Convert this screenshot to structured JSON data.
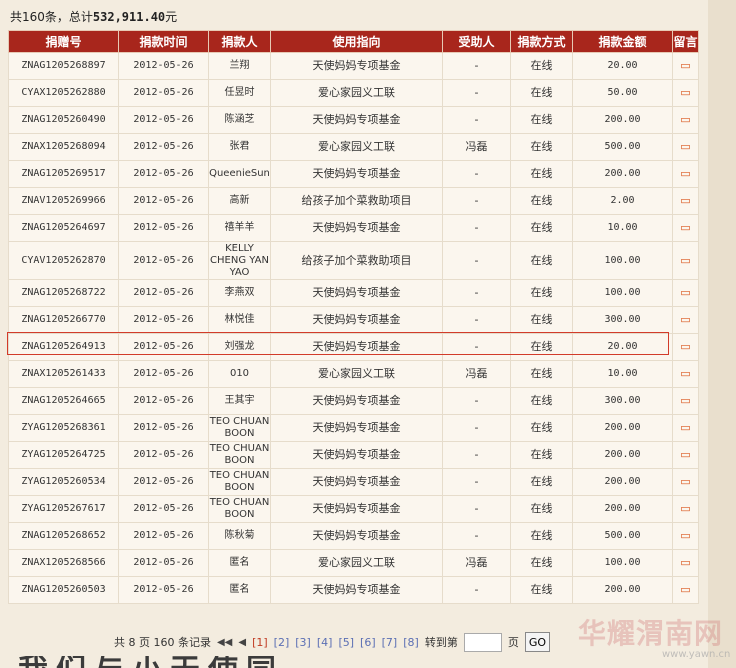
{
  "summary": {
    "prefix": "共160条，总计",
    "total": "532,911.40",
    "suffix": "元"
  },
  "table": {
    "headers": [
      "捐赠号",
      "捐款时间",
      "捐款人",
      "使用指向",
      "受助人",
      "捐款方式",
      "捐款金额",
      "留言"
    ],
    "rows": [
      {
        "id": "ZNAG1205268897",
        "date": "2012-05-26",
        "donor": "兰翔",
        "purpose": "天使妈妈专项基金",
        "recipient": "-",
        "method": "在线",
        "amount": "20.00"
      },
      {
        "id": "CYAX1205262880",
        "date": "2012-05-26",
        "donor": "任昱时",
        "purpose": "爱心家园义工联",
        "recipient": "-",
        "method": "在线",
        "amount": "50.00"
      },
      {
        "id": "ZNAG1205260490",
        "date": "2012-05-26",
        "donor": "陈涵芝",
        "purpose": "天使妈妈专项基金",
        "recipient": "-",
        "method": "在线",
        "amount": "200.00"
      },
      {
        "id": "ZNAX1205268094",
        "date": "2012-05-26",
        "donor": "张君",
        "purpose": "爱心家园义工联",
        "recipient": "冯磊",
        "method": "在线",
        "amount": "500.00"
      },
      {
        "id": "ZNAG1205269517",
        "date": "2012-05-26",
        "donor": "QueenieSun",
        "purpose": "天使妈妈专项基金",
        "recipient": "-",
        "method": "在线",
        "amount": "200.00"
      },
      {
        "id": "ZNAV1205269966",
        "date": "2012-05-26",
        "donor": "高新",
        "purpose": "给孩子加个菜救助项目",
        "recipient": "-",
        "method": "在线",
        "amount": "2.00"
      },
      {
        "id": "ZNAG1205264697",
        "date": "2012-05-26",
        "donor": "禧羊羊",
        "purpose": "天使妈妈专项基金",
        "recipient": "-",
        "method": "在线",
        "amount": "10.00"
      },
      {
        "id": "CYAV1205262870",
        "date": "2012-05-26",
        "donor": "KELLY CHENG YAN YAO",
        "purpose": "给孩子加个菜救助项目",
        "recipient": "-",
        "method": "在线",
        "amount": "100.00"
      },
      {
        "id": "ZNAG1205268722",
        "date": "2012-05-26",
        "donor": "李燕双",
        "purpose": "天使妈妈专项基金",
        "recipient": "-",
        "method": "在线",
        "amount": "100.00"
      },
      {
        "id": "ZNAG1205266770",
        "date": "2012-05-26",
        "donor": "林悦佳",
        "purpose": "天使妈妈专项基金",
        "recipient": "-",
        "method": "在线",
        "amount": "300.00"
      },
      {
        "id": "ZNAG1205264913",
        "date": "2012-05-26",
        "donor": "刘强龙",
        "purpose": "天使妈妈专项基金",
        "recipient": "-",
        "method": "在线",
        "amount": "20.00"
      },
      {
        "id": "ZNAX1205261433",
        "date": "2012-05-26",
        "donor": "010",
        "purpose": "爱心家园义工联",
        "recipient": "冯磊",
        "method": "在线",
        "amount": "10.00"
      },
      {
        "id": "ZNAG1205264665",
        "date": "2012-05-26",
        "donor": "王其宇",
        "purpose": "天使妈妈专项基金",
        "recipient": "-",
        "method": "在线",
        "amount": "300.00"
      },
      {
        "id": "ZYAG1205268361",
        "date": "2012-05-26",
        "donor": "TEO CHUAN BOON",
        "purpose": "天使妈妈专项基金",
        "recipient": "-",
        "method": "在线",
        "amount": "200.00"
      },
      {
        "id": "ZYAG1205264725",
        "date": "2012-05-26",
        "donor": "TEO CHUAN BOON",
        "purpose": "天使妈妈专项基金",
        "recipient": "-",
        "method": "在线",
        "amount": "200.00"
      },
      {
        "id": "ZYAG1205260534",
        "date": "2012-05-26",
        "donor": "TEO CHUAN BOON",
        "purpose": "天使妈妈专项基金",
        "recipient": "-",
        "method": "在线",
        "amount": "200.00"
      },
      {
        "id": "ZYAG1205267617",
        "date": "2012-05-26",
        "donor": "TEO CHUAN BOON",
        "purpose": "天使妈妈专项基金",
        "recipient": "-",
        "method": "在线",
        "amount": "200.00"
      },
      {
        "id": "ZNAG1205268652",
        "date": "2012-05-26",
        "donor": "陈秋菊",
        "purpose": "天使妈妈专项基金",
        "recipient": "-",
        "method": "在线",
        "amount": "500.00"
      },
      {
        "id": "ZNAX1205268566",
        "date": "2012-05-26",
        "donor": "匿名",
        "purpose": "爱心家园义工联",
        "recipient": "冯磊",
        "method": "在线",
        "amount": "100.00"
      },
      {
        "id": "ZNAG1205260503",
        "date": "2012-05-26",
        "donor": "匿名",
        "purpose": "天使妈妈专项基金",
        "recipient": "-",
        "method": "在线",
        "amount": "200.00"
      }
    ],
    "message_icon": "speech-bubble-icon"
  },
  "pager": {
    "total_pages_text": "共 8 页 160 条记录",
    "first_icon": "first-page-icon",
    "prev_icon": "prev-page-icon",
    "pages": [
      "[1]",
      "[2]",
      "[3]",
      "[4]",
      "[5]",
      "[6]",
      "[7]",
      "[8]"
    ],
    "current_page": "[1]",
    "goto_label": "转到第",
    "goto_value": "",
    "page_suffix": "页",
    "go_button": "GO"
  },
  "watermark": {
    "text": "华耀渭南网",
    "url": "www.yawn.cn"
  },
  "bottom_text": "我们与小天使同"
}
